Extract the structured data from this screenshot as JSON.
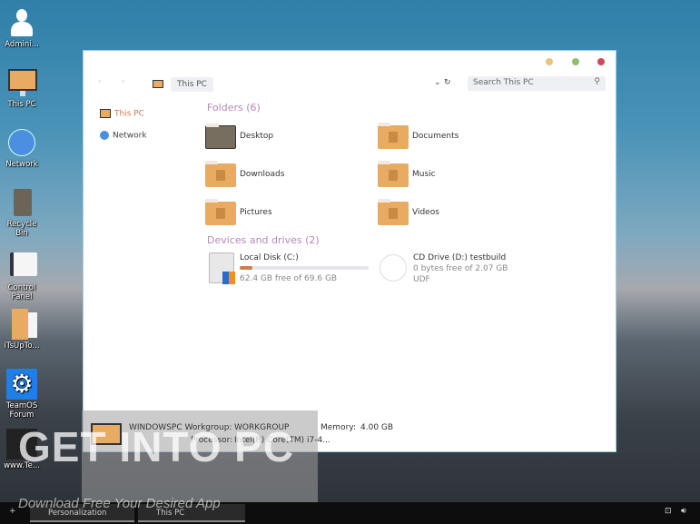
{
  "desktop": [
    {
      "label": "Admini...",
      "icon": "user-icon"
    },
    {
      "label": "This PC",
      "icon": "monitor-icon"
    },
    {
      "label": "Network",
      "icon": "network-globe-icon"
    },
    {
      "label": "Recycle Bin",
      "icon": "recycle-bin-icon"
    },
    {
      "label": "Control Panel",
      "icon": "control-panel-icon"
    },
    {
      "label": "iTsUpTo...",
      "icon": "folder-icon"
    },
    {
      "label": "TeamOS Forum",
      "icon": "gear-icon"
    },
    {
      "label": "www.Te...",
      "icon": "shortcut-icon"
    }
  ],
  "window": {
    "breadcrumb": "This PC",
    "search_placeholder": "Search This PC",
    "colors": {
      "minimize": "#e8c577",
      "maximize": "#8fbf6a",
      "close": "#d0485a"
    }
  },
  "sidebar": [
    {
      "label": "This PC",
      "active": true
    },
    {
      "label": "Network"
    }
  ],
  "folders": {
    "title": "Folders (6)",
    "items": [
      "Desktop",
      "Documents",
      "Downloads",
      "Music",
      "Pictures",
      "Videos"
    ]
  },
  "drives": {
    "title": "Devices and drives (2)",
    "items": [
      {
        "name": "Local Disk (C:)",
        "detail": "62.4 GB free of 69.6 GB",
        "used_percent": 10
      },
      {
        "name": "CD Drive (D:) testbuild",
        "detail": "0 bytes free of 2.07 GB",
        "fs": "UDF"
      }
    ]
  },
  "status": {
    "computer": "WINDOWSPC",
    "workgroup_label": "Workgroup:",
    "workgroup": "WORKGROUP",
    "memory_label": "Memory:",
    "memory": "4.00 GB",
    "processor_label": "Processor:",
    "processor": "Intel(R) Core(TM) i7-4..."
  },
  "watermark": {
    "logo": "GET INTO PC",
    "tagline": "Download Free Your Desired App"
  },
  "taskbar": {
    "items": [
      "Personalization",
      "This PC"
    ]
  }
}
